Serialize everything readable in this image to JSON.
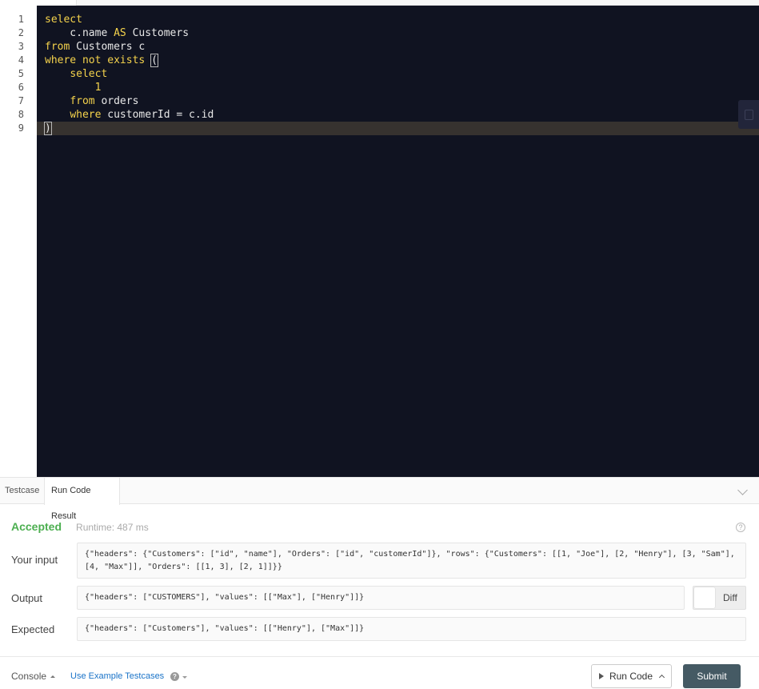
{
  "editor": {
    "line_numbers": [
      "1",
      "2",
      "3",
      "4",
      "5",
      "6",
      "7",
      "8",
      "9"
    ],
    "lines": [
      [
        {
          "t": "select",
          "c": "kw"
        }
      ],
      [
        {
          "t": "    c.name ",
          "c": ""
        },
        {
          "t": "AS",
          "c": "kw"
        },
        {
          "t": " Customers",
          "c": ""
        }
      ],
      [
        {
          "t": "from",
          "c": "kw"
        },
        {
          "t": " Customers c",
          "c": ""
        }
      ],
      [
        {
          "t": "where not exists",
          "c": "kw"
        },
        {
          "t": " ",
          "c": ""
        },
        {
          "t": "(",
          "c": "bracket"
        }
      ],
      [
        {
          "t": "    ",
          "c": ""
        },
        {
          "t": "select",
          "c": "kw"
        }
      ],
      [
        {
          "t": "        ",
          "c": ""
        },
        {
          "t": "1",
          "c": "num"
        }
      ],
      [
        {
          "t": "    ",
          "c": ""
        },
        {
          "t": "from",
          "c": "kw"
        },
        {
          "t": " orders",
          "c": ""
        }
      ],
      [
        {
          "t": "    ",
          "c": ""
        },
        {
          "t": "where",
          "c": "kw"
        },
        {
          "t": " customerId = c.id",
          "c": ""
        }
      ],
      [
        {
          "t": ")",
          "c": "bracket"
        }
      ]
    ],
    "active_line": 9,
    "colors": {
      "background": "#101321",
      "keyword": "#f5d34c",
      "text": "#e8e8e8",
      "active_line": "#36322f"
    }
  },
  "panel": {
    "tabs": [
      {
        "label": "Testcase",
        "active": false
      },
      {
        "label": "Run Code Result",
        "active": true
      }
    ]
  },
  "result": {
    "status": "Accepted",
    "runtime": "Runtime: 487 ms",
    "input_label": "Your input",
    "input_value": "{\"headers\": {\"Customers\": [\"id\", \"name\"], \"Orders\": [\"id\", \"customerId\"]}, \"rows\": {\"Customers\": [[1, \"Joe\"], [2, \"Henry\"], [3, \"Sam\"], [4, \"Max\"]], \"Orders\": [[1, 3], [2, 1]]}}",
    "output_label": "Output",
    "output_value": "{\"headers\": [\"CUSTOMERS\"], \"values\": [[\"Max\"], [\"Henry\"]]}",
    "expected_label": "Expected",
    "expected_value": "{\"headers\": [\"Customers\"], \"values\": [[\"Henry\"], [\"Max\"]]}",
    "diff_label": "Diff",
    "status_color": "#4caf50"
  },
  "footer": {
    "console_label": "Console",
    "example_link": "Use Example Testcases",
    "run_label": "Run Code",
    "submit_label": "Submit",
    "submit_color": "#455a64",
    "link_color": "#1a73c8"
  },
  "icons": {
    "help": "question-circle-icon",
    "collapse": "chevron-down-icon",
    "play": "play-icon"
  }
}
